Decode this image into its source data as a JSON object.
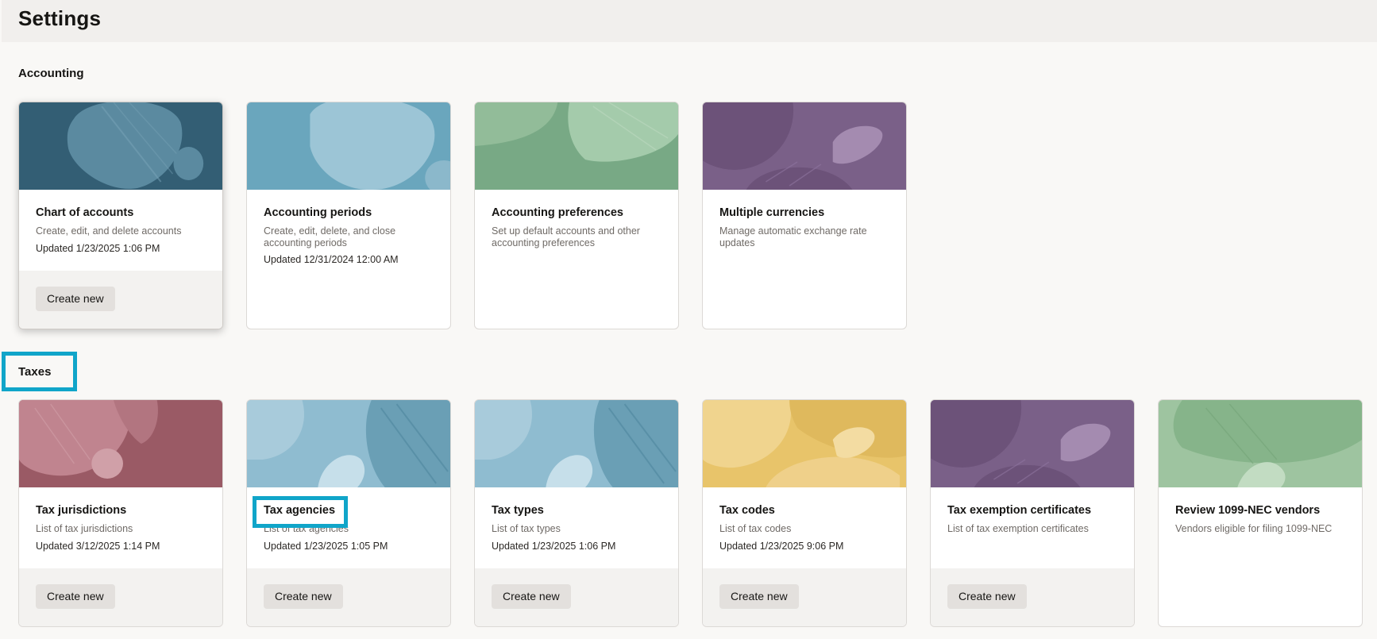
{
  "page": {
    "title": "Settings"
  },
  "sections": {
    "accounting": {
      "title": "Accounting",
      "cards": [
        {
          "title": "Chart of accounts",
          "description": "Create, edit, and delete accounts",
          "updated": "Updated 1/23/2025 1:06 PM",
          "button": "Create new"
        },
        {
          "title": "Accounting periods",
          "description": "Create, edit, delete, and close accounting periods",
          "updated": "Updated 12/31/2024 12:00 AM"
        },
        {
          "title": "Accounting preferences",
          "description": "Set up default accounts and other accounting preferences"
        },
        {
          "title": "Multiple currencies",
          "description": "Manage automatic exchange rate updates"
        }
      ]
    },
    "taxes": {
      "title": "Taxes",
      "cards": [
        {
          "title": "Tax jurisdictions",
          "description": "List of tax jurisdictions",
          "updated": "Updated 3/12/2025 1:14 PM",
          "button": "Create new"
        },
        {
          "title": "Tax agencies",
          "description": "List of tax agencies",
          "updated": "Updated 1/23/2025 1:05 PM",
          "button": "Create new"
        },
        {
          "title": "Tax types",
          "description": "List of tax types",
          "updated": "Updated 1/23/2025 1:06 PM",
          "button": "Create new"
        },
        {
          "title": "Tax codes",
          "description": "List of tax codes",
          "updated": "Updated 1/23/2025 9:06 PM",
          "button": "Create new"
        },
        {
          "title": "Tax exemption certificates",
          "description": "List of tax exemption certificates",
          "button": "Create new"
        },
        {
          "title": "Review 1099-NEC vendors",
          "description": "Vendors eligible for filing 1099-NEC"
        }
      ]
    }
  },
  "colors": {
    "highlight": "#10a5c9",
    "banner_dark_teal": "#335e74",
    "banner_light_blue": "#6aa6bd",
    "banner_green": "#78a985",
    "banner_purple": "#7a6088",
    "banner_rose": "#9a5a65",
    "banner_pale_blue": "#8fbcd0",
    "banner_yellow": "#e8c46a",
    "banner_sage": "#9ec4a0"
  }
}
